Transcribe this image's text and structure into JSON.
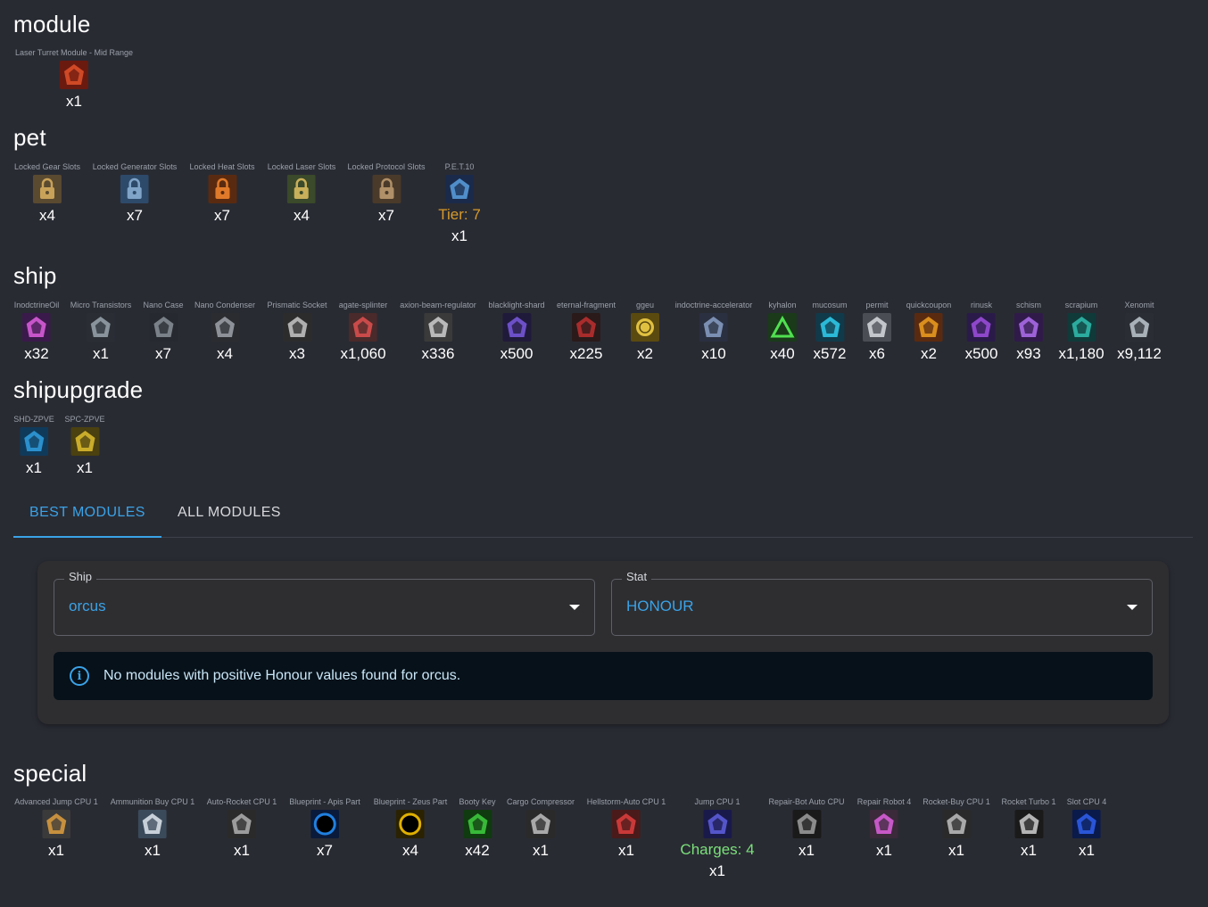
{
  "sections": {
    "module": {
      "title": "module",
      "items": [
        {
          "name": "Laser Turret Module - Mid Range",
          "count": "x1",
          "icon": "laser-turret-icon",
          "colors": [
            "#6b1a10",
            "#e0522a"
          ]
        }
      ]
    },
    "pet": {
      "title": "pet",
      "items": [
        {
          "name": "Locked Gear Slots",
          "count": "x4",
          "icon": "padlock-gear-icon",
          "colors": [
            "#5a4a30",
            "#c9a25a"
          ]
        },
        {
          "name": "Locked Generator Slots",
          "count": "x7",
          "icon": "padlock-generator-icon",
          "colors": [
            "#2e4a6a",
            "#7fa4c8"
          ]
        },
        {
          "name": "Locked Heat Slots",
          "count": "x7",
          "icon": "padlock-heat-icon",
          "colors": [
            "#5a2a10",
            "#e07a2a"
          ]
        },
        {
          "name": "Locked Laser Slots",
          "count": "x4",
          "icon": "padlock-laser-icon",
          "colors": [
            "#3a4a2a",
            "#c9b05a"
          ]
        },
        {
          "name": "Locked Protocol Slots",
          "count": "x7",
          "icon": "padlock-protocol-icon",
          "colors": [
            "#4a3a2a",
            "#b09068"
          ]
        },
        {
          "name": "P.E.T.10",
          "count": "x1",
          "icon": "pet-drone-icon",
          "colors": [
            "#1a2a4a",
            "#5aa0e0"
          ],
          "tier": "Tier: 7"
        }
      ]
    },
    "ship": {
      "title": "ship",
      "items": [
        {
          "name": "InodctrineOil",
          "count": "x32",
          "icon": "inodctrine-oil-icon",
          "colors": [
            "#3a1a4a",
            "#e060e0"
          ]
        },
        {
          "name": "Micro Transistors",
          "count": "x1",
          "icon": "micro-transistors-icon",
          "colors": [
            "#2a2e34",
            "#9aa4ae"
          ]
        },
        {
          "name": "Nano Case",
          "count": "x7",
          "icon": "nano-case-icon",
          "colors": [
            "#262a30",
            "#8a9098"
          ]
        },
        {
          "name": "Nano Condenser",
          "count": "x4",
          "icon": "nano-condenser-icon",
          "colors": [
            "#2a2c30",
            "#a0a4aa"
          ]
        },
        {
          "name": "Prismatic Socket",
          "count": "x3",
          "icon": "prismatic-socket-icon",
          "colors": [
            "#2c2c2c",
            "#c8c8c8"
          ]
        },
        {
          "name": "agate-splinter",
          "count": "x1,060",
          "icon": "agate-splinter-icon",
          "colors": [
            "#4a2a2a",
            "#e05050"
          ]
        },
        {
          "name": "axion-beam-regulator",
          "count": "x336",
          "icon": "axion-beam-regulator-icon",
          "colors": [
            "#3a3a3a",
            "#d0d0d0"
          ]
        },
        {
          "name": "blacklight-shard",
          "count": "x500",
          "icon": "blacklight-shard-icon",
          "colors": [
            "#201a3a",
            "#7a5ae0"
          ]
        },
        {
          "name": "eternal-fragment",
          "count": "x225",
          "icon": "eternal-fragment-icon",
          "colors": [
            "#2a1a1a",
            "#c03030"
          ]
        },
        {
          "name": "ggeu",
          "count": "x2",
          "icon": "ggeu-coin-icon",
          "colors": [
            "#5a4a10",
            "#e0c040"
          ]
        },
        {
          "name": "indoctrine-accelerator",
          "count": "x10",
          "icon": "indoctrine-accelerator-icon",
          "colors": [
            "#2a3040",
            "#8aa0c8"
          ]
        },
        {
          "name": "kyhalon",
          "count": "x40",
          "icon": "kyhalon-icon",
          "colors": [
            "#1a3a1a",
            "#50e050"
          ]
        },
        {
          "name": "mucosum",
          "count": "x572",
          "icon": "mucosum-icon",
          "colors": [
            "#103a4a",
            "#30d0f0"
          ]
        },
        {
          "name": "permit",
          "count": "x6",
          "icon": "permit-icon",
          "colors": [
            "#4a4e54",
            "#d8dde2"
          ]
        },
        {
          "name": "quickcoupon",
          "count": "x2",
          "icon": "quickcoupon-icon",
          "colors": [
            "#5a2a10",
            "#f0a020"
          ]
        },
        {
          "name": "rinusk",
          "count": "x500",
          "icon": "rinusk-icon",
          "colors": [
            "#2a1a4a",
            "#a050e0"
          ]
        },
        {
          "name": "schism",
          "count": "x93",
          "icon": "schism-icon",
          "colors": [
            "#301a4a",
            "#b070f0"
          ]
        },
        {
          "name": "scrapium",
          "count": "x1,180",
          "icon": "scrapium-icon",
          "colors": [
            "#103a3a",
            "#30c0b0"
          ]
        },
        {
          "name": "Xenomit",
          "count": "x9,112",
          "icon": "xenomit-icon",
          "colors": [
            "#2a2e34",
            "#c0c8d0"
          ]
        }
      ]
    },
    "shipupgrade": {
      "title": "shipupgrade",
      "items": [
        {
          "name": "SHD-ZPVE",
          "count": "x1",
          "icon": "shd-zpve-icon",
          "colors": [
            "#103a5a",
            "#30a0e0"
          ]
        },
        {
          "name": "SPC-ZPVE",
          "count": "x1",
          "icon": "spc-zpve-icon",
          "colors": [
            "#4a4010",
            "#e0c030"
          ]
        }
      ]
    },
    "special": {
      "title": "special",
      "items": [
        {
          "name": "Advanced Jump CPU 1",
          "count": "x1",
          "icon": "advanced-jump-cpu-icon",
          "colors": [
            "#3a3a3a",
            "#e0a040"
          ]
        },
        {
          "name": "Ammunition Buy CPU 1",
          "count": "x1",
          "icon": "ammunition-buy-cpu-icon",
          "colors": [
            "#3a4a5a",
            "#e0e8f0"
          ]
        },
        {
          "name": "Auto-Rocket CPU 1",
          "count": "x1",
          "icon": "auto-rocket-cpu-icon",
          "colors": [
            "#2a2a2a",
            "#b0b0b0"
          ]
        },
        {
          "name": "Blueprint - Apis Part",
          "count": "x7",
          "icon": "blueprint-apis-icon",
          "colors": [
            "#0a1a3a",
            "#2080e0"
          ]
        },
        {
          "name": "Blueprint - Zeus Part",
          "count": "x4",
          "icon": "blueprint-zeus-icon",
          "colors": [
            "#2a2200",
            "#e0b000"
          ]
        },
        {
          "name": "Booty Key",
          "count": "x42",
          "icon": "booty-key-icon",
          "colors": [
            "#103a10",
            "#40d040"
          ]
        },
        {
          "name": "Cargo Compressor",
          "count": "x1",
          "icon": "cargo-compressor-icon",
          "colors": [
            "#2a2a2a",
            "#c0c0c0"
          ]
        },
        {
          "name": "Hellstorm-Auto CPU 1",
          "count": "x1",
          "icon": "hellstorm-auto-cpu-icon",
          "colors": [
            "#4a1a1a",
            "#e04040"
          ]
        },
        {
          "name": "Jump CPU 1",
          "count": "x1",
          "icon": "jump-cpu-icon",
          "colors": [
            "#1a1a4a",
            "#6060e0"
          ],
          "charges": "Charges: 4"
        },
        {
          "name": "Repair-Bot Auto CPU",
          "count": "x1",
          "icon": "repair-bot-auto-cpu-icon",
          "colors": [
            "#1a1a1a",
            "#a0a0a0"
          ]
        },
        {
          "name": "Repair Robot 4",
          "count": "x1",
          "icon": "repair-robot-icon",
          "colors": [
            "#3a2a3a",
            "#e060e0"
          ]
        },
        {
          "name": "Rocket-Buy CPU 1",
          "count": "x1",
          "icon": "rocket-buy-cpu-icon",
          "colors": [
            "#2a2a2a",
            "#c0c0c0"
          ]
        },
        {
          "name": "Rocket Turbo 1",
          "count": "x1",
          "icon": "rocket-turbo-icon",
          "colors": [
            "#1a1a1a",
            "#d0d0d0"
          ]
        },
        {
          "name": "Slot CPU 4",
          "count": "x1",
          "icon": "slot-cpu-icon",
          "colors": [
            "#0a1a4a",
            "#3060f0"
          ]
        }
      ]
    }
  },
  "tabs": [
    {
      "label": "BEST MODULES",
      "active": true
    },
    {
      "label": "ALL MODULES",
      "active": false
    }
  ],
  "filters": {
    "ship": {
      "label": "Ship",
      "value": "orcus"
    },
    "stat": {
      "label": "Stat",
      "value": "HONOUR"
    }
  },
  "alert": {
    "icon": "info-icon",
    "text": "No modules with positive Honour values found for orcus."
  },
  "colors": {
    "background": "#292b33",
    "accent": "#3aa3e8",
    "tier": "#d89a2a",
    "charges": "#7be07a"
  }
}
